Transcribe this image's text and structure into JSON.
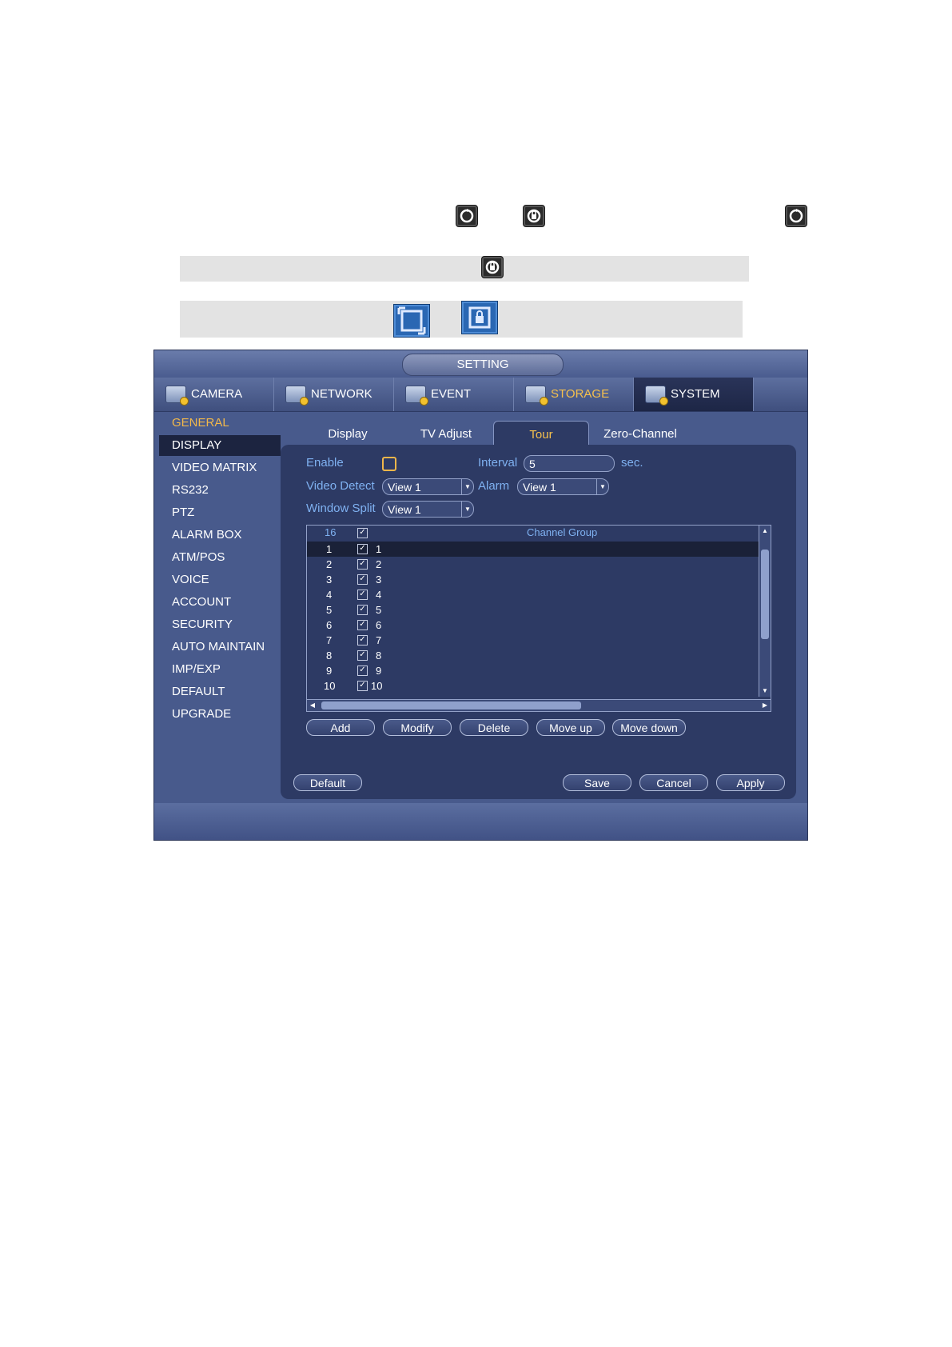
{
  "doc_icons": [
    "tour-icon",
    "tour-locked-icon",
    "tour-icon",
    "tour-locked-icon",
    "window-icon",
    "window-locked-icon"
  ],
  "window": {
    "title": "SETTING",
    "main_tabs": [
      {
        "label": "CAMERA",
        "icon": "camera-icon"
      },
      {
        "label": "NETWORK",
        "icon": "network-icon"
      },
      {
        "label": "EVENT",
        "icon": "event-icon"
      },
      {
        "label": "STORAGE",
        "icon": "storage-icon"
      },
      {
        "label": "SYSTEM",
        "icon": "system-icon"
      }
    ],
    "sidebar": {
      "group": "GENERAL",
      "items": [
        "DISPLAY",
        "VIDEO MATRIX",
        "RS232",
        "PTZ",
        "ALARM BOX",
        "ATM/POS",
        "VOICE",
        "ACCOUNT",
        "SECURITY",
        "AUTO MAINTAIN",
        "IMP/EXP",
        "DEFAULT",
        "UPGRADE"
      ],
      "active": "DISPLAY"
    },
    "sub_tabs": [
      "Display",
      "TV Adjust",
      "Tour",
      "Zero-Channel"
    ],
    "active_sub_tab": "Tour",
    "form": {
      "enable_label": "Enable",
      "enable_checked": false,
      "interval_label": "Interval",
      "interval_value": "5",
      "interval_unit": "sec.",
      "video_detect_label": "Video Detect",
      "video_detect_value": "View 1",
      "alarm_label": "Alarm",
      "alarm_value": "View 1",
      "window_split_label": "Window Split",
      "window_split_value": "View 1"
    },
    "table": {
      "count_header": "16",
      "group_header": "Channel Group",
      "rows": [
        {
          "num": "1",
          "group": "1"
        },
        {
          "num": "2",
          "group": "2"
        },
        {
          "num": "3",
          "group": "3"
        },
        {
          "num": "4",
          "group": "4"
        },
        {
          "num": "5",
          "group": "5"
        },
        {
          "num": "6",
          "group": "6"
        },
        {
          "num": "7",
          "group": "7"
        },
        {
          "num": "8",
          "group": "8"
        },
        {
          "num": "9",
          "group": "9"
        },
        {
          "num": "10",
          "group": "10"
        }
      ],
      "check_mark": "✓"
    },
    "list_buttons": {
      "add": "Add",
      "modify": "Modify",
      "delete": "Delete",
      "move_up": "Move up",
      "move_down": "Move down"
    },
    "footer_buttons": {
      "default": "Default",
      "save": "Save",
      "cancel": "Cancel",
      "apply": "Apply"
    },
    "colors": {
      "label_blue": "#7fb1f1",
      "highlight_orange": "#f5c04d",
      "panel": "#2d3a64"
    }
  }
}
